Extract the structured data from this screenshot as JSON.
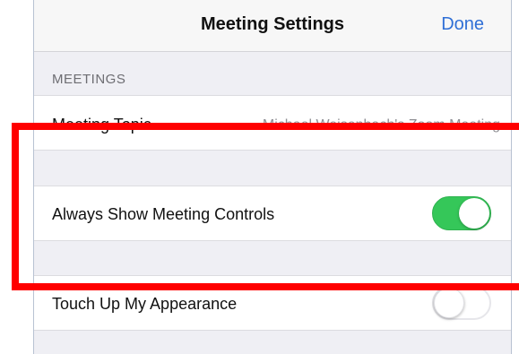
{
  "nav": {
    "title": "Meeting Settings",
    "done_label": "Done"
  },
  "section": {
    "header": "MEETINGS"
  },
  "rows": [
    {
      "label": "Meeting Topic",
      "value": "Michael Weisenbach's Zoom Meeting"
    },
    {
      "label": "Always Show Meeting Controls",
      "toggle_on": true
    },
    {
      "label": "Touch Up My Appearance",
      "toggle_on": false
    }
  ],
  "colors": {
    "accent": "#2f6fd6",
    "toggle_on": "#35c759",
    "highlight": "#ff0000",
    "grouped_background": "#efeff4"
  }
}
